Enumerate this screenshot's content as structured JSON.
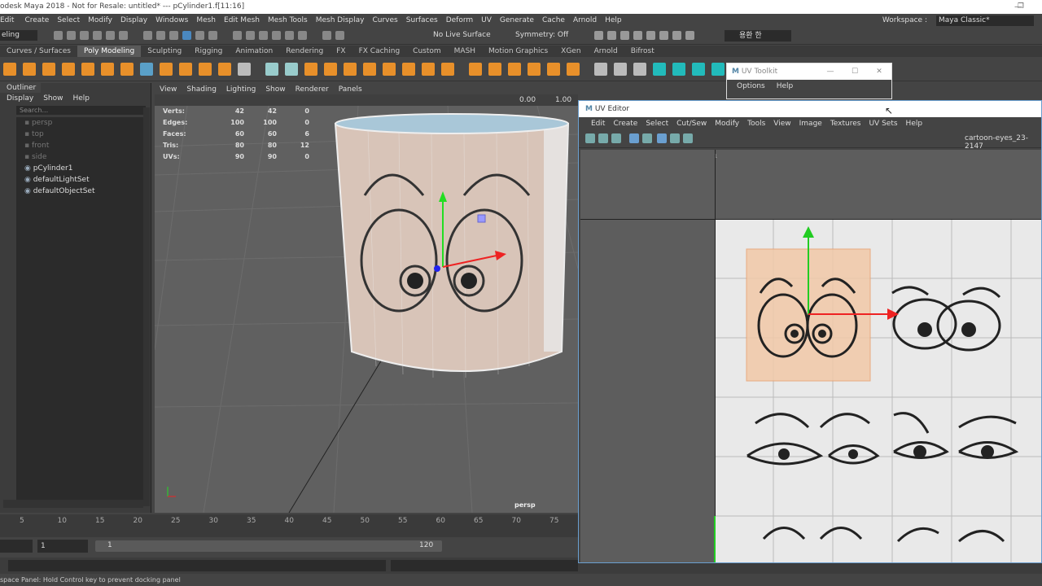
{
  "window": {
    "title": "odesk Maya 2018 - Not for Resale: untitled*   ---   pCylinder1.f[11:16]"
  },
  "menubar": {
    "items": [
      "Edit",
      "Create",
      "Select",
      "Modify",
      "Display",
      "Windows",
      "Mesh",
      "Edit Mesh",
      "Mesh Tools",
      "Mesh Display",
      "Curves",
      "Surfaces",
      "Deform",
      "UV",
      "Generate",
      "Cache",
      "Arnold",
      "Help"
    ],
    "workspace_label": "Workspace :",
    "workspace_value": "Maya Classic*"
  },
  "statusline": {
    "mode": "eling",
    "live_surface": "No Live Surface",
    "symmetry": "Symmetry: Off",
    "user": "용환 한"
  },
  "shelf": {
    "tabs": [
      "Curves / Surfaces",
      "Poly Modeling",
      "Sculpting",
      "Rigging",
      "Animation",
      "Rendering",
      "FX",
      "FX Caching",
      "Custom",
      "MASH",
      "Motion Graphics",
      "XGen",
      "Arnold",
      "Bifrost"
    ],
    "active_tab": "Poly Modeling"
  },
  "outliner": {
    "title": "Outliner",
    "menu": [
      "Display",
      "Show",
      "Help"
    ],
    "search_placeholder": "Search...",
    "items": [
      {
        "label": "persp",
        "dim": true
      },
      {
        "label": "top",
        "dim": true
      },
      {
        "label": "front",
        "dim": true
      },
      {
        "label": "side",
        "dim": true
      },
      {
        "label": "pCylinder1",
        "dim": false
      },
      {
        "label": "defaultLightSet",
        "dim": false
      },
      {
        "label": "defaultObjectSet",
        "dim": false
      }
    ]
  },
  "viewport": {
    "menu": [
      "View",
      "Shading",
      "Lighting",
      "Show",
      "Renderer",
      "Panels"
    ],
    "field1": "0.00",
    "field2": "1.00",
    "camera": "persp",
    "hud": [
      {
        "label": "Verts:",
        "a": "42",
        "b": "42",
        "c": "0"
      },
      {
        "label": "Edges:",
        "a": "100",
        "b": "100",
        "c": "0"
      },
      {
        "label": "Faces:",
        "a": "60",
        "b": "60",
        "c": "6"
      },
      {
        "label": "Tris:",
        "a": "80",
        "b": "80",
        "c": "12"
      },
      {
        "label": "UVs:",
        "a": "90",
        "b": "90",
        "c": "0"
      }
    ]
  },
  "timeline": {
    "ticks": [
      "5",
      "10",
      "15",
      "20",
      "25",
      "30",
      "35",
      "40",
      "45",
      "50",
      "55",
      "60",
      "65",
      "70",
      "75"
    ],
    "start": "1",
    "range_start": "1",
    "range_end": "120"
  },
  "helpline": "space Panel: Hold Control key to prevent docking panel",
  "uv_toolkit": {
    "title": "UV Toolkit",
    "menu": [
      "Options",
      "Help"
    ]
  },
  "uv_editor": {
    "title": "UV Editor",
    "menu": [
      "Edit",
      "Create",
      "Select",
      "Cut/Sew",
      "Modify",
      "Tools",
      "View",
      "Image",
      "Textures",
      "UV Sets",
      "Help"
    ],
    "texture_name": "cartoon-eyes_23-2147",
    "corner": "1"
  },
  "colors": {
    "accent": "#5285a6",
    "shelf_active": "#5a5a5a",
    "uv_shell": "#e8a070"
  }
}
